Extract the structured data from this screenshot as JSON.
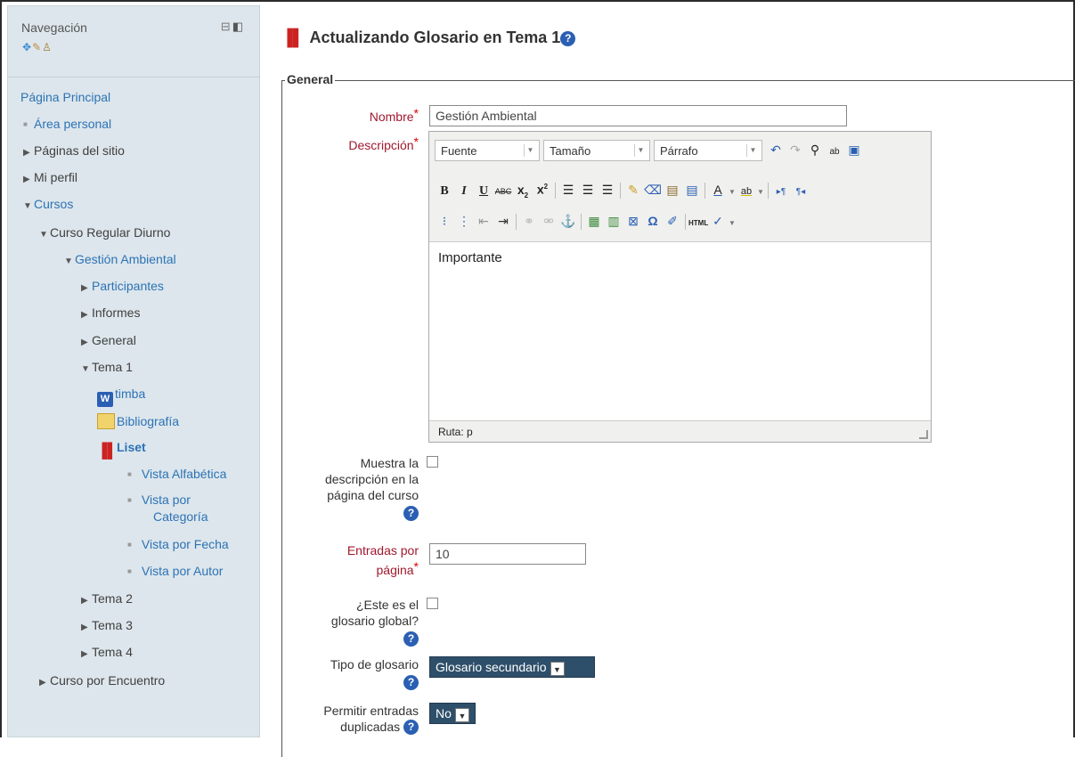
{
  "nav": {
    "title": "Navegación",
    "items": [
      {
        "label": "Página Principal"
      },
      {
        "label": "Área personal"
      },
      {
        "label": "Páginas del sitio"
      },
      {
        "label": "Mi perfil"
      },
      {
        "label": "Cursos"
      },
      {
        "label": "Curso Regular Diurno"
      },
      {
        "label": "Gestión Ambiental"
      },
      {
        "label": "Participantes"
      },
      {
        "label": "Informes"
      },
      {
        "label": "General"
      },
      {
        "label": "Tema 1"
      },
      {
        "label": "timba"
      },
      {
        "label": "Bibliografía"
      },
      {
        "label": "Liset"
      },
      {
        "label": "Vista Alfabética"
      },
      {
        "label": "Vista por"
      },
      {
        "label": "Categoría"
      },
      {
        "label": "Vista por Fecha"
      },
      {
        "label": "Vista por Autor"
      },
      {
        "label": "Tema 2"
      },
      {
        "label": "Tema 3"
      },
      {
        "label": "Tema 4"
      },
      {
        "label": "Curso por Encuentro"
      }
    ]
  },
  "page": {
    "title": "Actualizando Glosario en Tema 1",
    "legend": "General"
  },
  "form": {
    "nombre_label": "Nombre",
    "nombre_value": "Gestión Ambiental",
    "descripcion_label": "Descripción",
    "editor": {
      "font": "Fuente",
      "size": "Tamaño",
      "format": "Párrafo",
      "content": "Importante",
      "status": "Ruta: p"
    },
    "muestra_label_1": "Muestra la",
    "muestra_label_2": "descripción en la",
    "muestra_label_3": "página del curso",
    "entradas_label_1": "Entradas por",
    "entradas_label_2": "página",
    "entradas_value": "10",
    "global_label_1": "¿Este es el",
    "global_label_2": "glosario global?",
    "tipo_label": "Tipo de glosario",
    "tipo_value": "Glosario secundario",
    "permitir_label_1": "Permitir entradas",
    "permitir_label_2": "duplicadas",
    "permitir_value": "No"
  },
  "colors": {
    "link": "#2c73b5",
    "required": "#a0192e",
    "sidebar_bg": "#dde6ec",
    "select_bg": "#2e4f6a"
  }
}
